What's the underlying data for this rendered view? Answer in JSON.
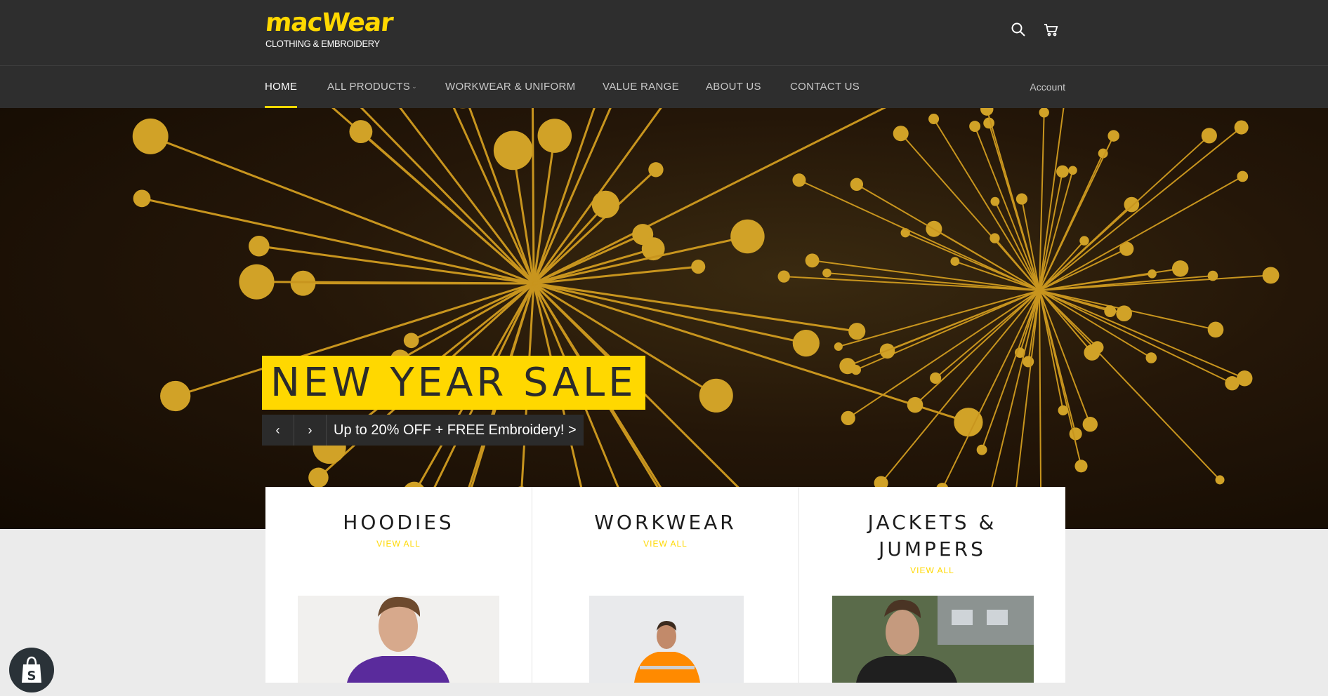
{
  "brand": {
    "logo_main": "macWear",
    "logo_sub": "CLOTHING & EMBROIDERY",
    "accent": "#ffd800",
    "header_bg": "#2e2e2e"
  },
  "header": {
    "search_icon": "search-icon",
    "cart_icon": "cart-icon"
  },
  "nav": {
    "items": [
      {
        "label": "HOME",
        "active": true
      },
      {
        "label": "ALL PRODUCTS",
        "has_dropdown": true
      },
      {
        "label": "WORKWEAR & UNIFORM"
      },
      {
        "label": "VALUE RANGE"
      },
      {
        "label": "ABOUT US"
      },
      {
        "label": "CONTACT US"
      }
    ],
    "caret": "⌄",
    "account": "Account"
  },
  "hero": {
    "title": "NEW YEAR SALE",
    "prev": "‹",
    "next": "›",
    "link": "Up to 20% OFF + FREE Embroidery! >"
  },
  "collections": [
    {
      "title": "HOODIES",
      "link": "VIEW ALL"
    },
    {
      "title": "WORKWEAR",
      "link": "VIEW ALL"
    },
    {
      "title": "JACKETS & JUMPERS",
      "link": "VIEW ALL"
    }
  ],
  "shopify_badge": "shopify-bag-icon"
}
